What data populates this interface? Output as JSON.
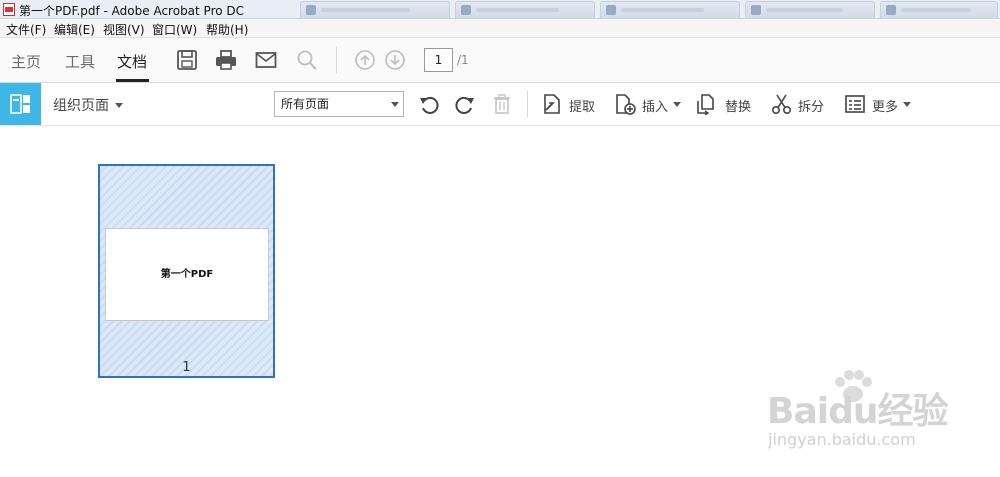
{
  "window": {
    "title": "第一个PDF.pdf - Adobe Acrobat Pro DC"
  },
  "menubar": {
    "items": [
      "文件(F)",
      "编辑(E)",
      "视图(V)",
      "窗口(W)",
      "帮助(H)"
    ]
  },
  "toolbar": {
    "tabs": [
      "主页",
      "工具",
      "文档"
    ],
    "active_tab": "文档",
    "icons": [
      "save-icon",
      "print-icon",
      "email-icon",
      "search-icon",
      "page-up-icon",
      "page-down-icon"
    ],
    "page_current": "1",
    "page_total": "/1"
  },
  "organize": {
    "label": "组织页面",
    "page_range_select": "所有页面",
    "actions": [
      {
        "name": "extract",
        "label": "提取",
        "icon": "extract-icon"
      },
      {
        "name": "insert",
        "label": "插入",
        "icon": "insert-icon",
        "dropdown": true
      },
      {
        "name": "replace",
        "label": "替换",
        "icon": "replace-icon"
      },
      {
        "name": "split",
        "label": "拆分",
        "icon": "scissors-icon"
      },
      {
        "name": "more",
        "label": "更多",
        "icon": "more-icon",
        "dropdown": true
      }
    ],
    "tool_icons": [
      "rotate-left-icon",
      "rotate-right-icon",
      "delete-icon"
    ]
  },
  "thumbnails": [
    {
      "page_text": "第一个PDF",
      "number": "1",
      "selected": true
    }
  ],
  "watermark": {
    "logo": "Baidu经验",
    "sub": "jingyan.baidu.com"
  },
  "colors": {
    "accent": "#3fb7e6",
    "selection_border": "#2f73c9",
    "selection_fill": "#dde9f8"
  }
}
